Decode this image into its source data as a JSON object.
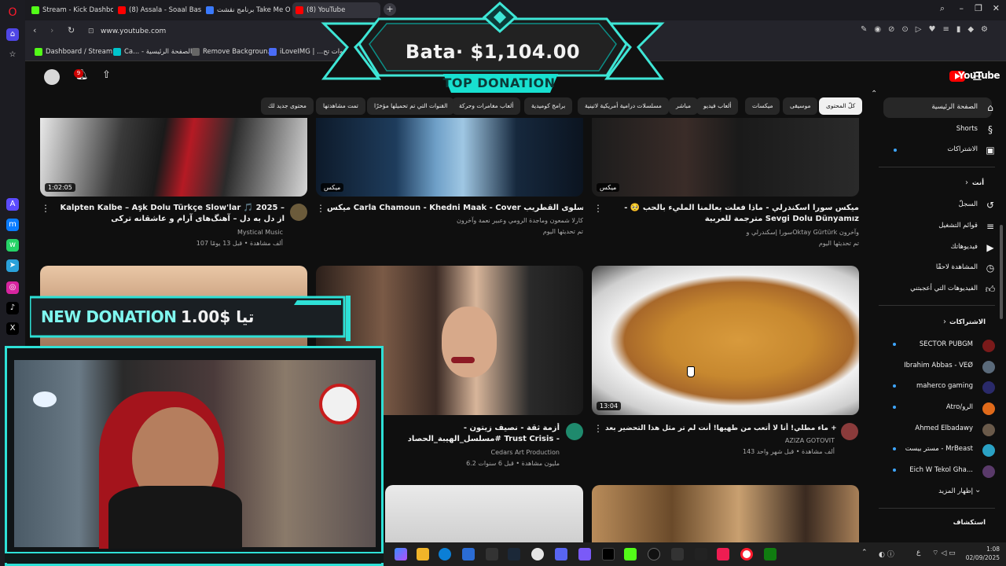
{
  "browser": {
    "tabs": [
      {
        "label": "Stream - Kick Dashboard",
        "color": "#53fc18"
      },
      {
        "label": "(8) Assala - Soaal Basit | ط",
        "color": "#ff0000"
      },
      {
        "label": "برنامج نقشت Take Me Out",
        "color": "#3a7afe"
      },
      {
        "label": "(8) YouTube",
        "color": "#ff0000"
      }
    ],
    "new_tab": "+",
    "url": "www.youtube.com",
    "bookmarks": [
      "Dashboard / Stream...",
      "Ca... - الصفحة الرئيسية",
      "Remove Backgroun...",
      "iLoveIMG | ...أدوات تح"
    ]
  },
  "overlay": {
    "top_donation_amount": "Bata· $1,104.00",
    "top_donation_label": "TOP DONATION",
    "new_donation_label": "NEW DONATION",
    "new_donation_value": "تيا $1.00"
  },
  "youtube": {
    "logo": "YouTube",
    "notif_count": "9",
    "chips": [
      "كلّ المحتوى",
      "موسيقى",
      "ميكسات",
      "ألعاب فيديو",
      "مباشر",
      "مسلسلات درامية أمريكية لاتينية",
      "برامج كوميدية",
      "ألعاب مغامرات وحركة",
      "القنوات التي تم تحميلها مؤخرًا",
      "تمت مشاهدتها",
      "محتوى جديد لك"
    ],
    "videos": [
      {
        "title": "Kalpten Kalbe – Aşk Dolu Türkçe Slow'lar 🎵 2025 – از دل به دل – آهنگ‌های آرام و عاشقانه ترکی",
        "channel": "Mystical Music",
        "meta": "107 ألف مشاهدة • قبل 13 يومًا",
        "duration": "1:02:05"
      },
      {
        "title": "ميكس Carla Chamoun - Khedni Maak - Cover خدني معك - سلوى القطريب",
        "channel": "كارلا شمعون وماجدة الرومي وعبير نعمة وآخرون",
        "meta": "تم تحديثها اليوم",
        "duration": "ميكس"
      },
      {
        "title": "ميكس سورا اسكندرلي - ماذا فعلت بعالمنا المليء بالحب 🥺 - مترجمة للعربية Sevgi Dolu Dünyamız",
        "channel": "سورا إسكندرلي وOktay Gürtürk وآخرون",
        "meta": "تم تحديثها اليوم",
        "duration": "ميكس"
      },
      {
        "title": "أزمة ثقة - نصيف زيتون - #مسلسل_الهيبة_الحصاد Trust Crisis - Nassif Zeytoun #videoclip",
        "channel": "Cedars Art Production",
        "meta": "6.2 مليون مشاهدة • قبل 6 سنوات",
        "duration": ""
      },
      {
        "title": "دهني + ماء مطلي! أنا لا أتعب من طهيها! أنت لم تر مثل هذا التحضير بعد!",
        "channel": "AZIZA GOTOVIT",
        "meta": "143 ألف مشاهدة • قبل شهر واحد",
        "duration": "13:04"
      }
    ],
    "sidebar": {
      "main": [
        "الصفحة الرئيسية",
        "Shorts",
        "الاشتراكات"
      ],
      "you_header": "أنت",
      "you": [
        "السجلّ",
        "قوائم التشغيل",
        "فيديوهاتك",
        "المشاهدة لاحقًا",
        "الفيديوهات التي أعجبتني"
      ],
      "subs_header": "الاشتراكات",
      "subs": [
        "SECTOR PUBGM",
        "Ibrahim Abbas - VEØ",
        "maherco gaming",
        "Atro/الرو",
        "Ahmed Elbadawy",
        "مستر بيست - MrBeast",
        "Eich W Tekol Gha..."
      ],
      "show_more": "إظهار المزيد",
      "explore": "استكشاف"
    }
  },
  "taskbar": {
    "time": "1:08",
    "date": "02/09/2025",
    "lang": "ع"
  }
}
